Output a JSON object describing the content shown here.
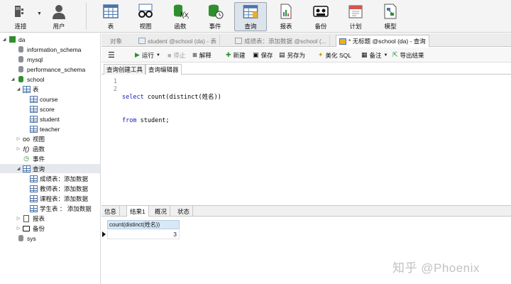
{
  "toolbar": {
    "connect": "连接",
    "user": "用户",
    "table": "表",
    "view": "视图",
    "function": "函数",
    "event": "事件",
    "query": "查询",
    "report": "报表",
    "backup": "备份",
    "schedule": "计划",
    "model": "模型"
  },
  "tree": {
    "connection": "da",
    "databases": [
      "information_schema",
      "mysql",
      "performance_schema",
      "school",
      "sys"
    ],
    "school": {
      "tables_label": "表",
      "tables": [
        "course",
        "score",
        "student",
        "teacher"
      ],
      "views_label": "视图",
      "functions_label": "函数",
      "events_label": "事件",
      "queries_label": "查询",
      "queries": [
        "成绩表：添加数据",
        "教师表：添加数据",
        "课程表：添加数据",
        "学生表 ： 添加数据"
      ],
      "reports_label": "报表",
      "backups_label": "备份"
    }
  },
  "tabs": [
    "对象",
    "student @school (da) - 表",
    "成绩表：添加数据 @school (...",
    "* 无标题 @school (da) - 查询"
  ],
  "query_toolbar": {
    "menu": "☰",
    "run": "运行",
    "stop": "停止",
    "explain": "解释",
    "new": "新建",
    "save": "保存",
    "save_as": "另存为",
    "beautify": "美化 SQL",
    "comment": "备注",
    "export": "导出结果"
  },
  "subtabs": [
    "查询创建工具",
    "查询编辑器"
  ],
  "editor": {
    "line_numbers": [
      "1",
      "2"
    ],
    "line1_kw": "select",
    "line1_rest": " count(distinct(姓名))",
    "line2_kw": "from",
    "line2_rest": " student;"
  },
  "result_tabs": [
    "信息",
    "结果1",
    "概况",
    "状态"
  ],
  "result": {
    "column": "count(distinct(姓名))",
    "value": "3"
  },
  "watermark": "知乎 @Phoenix",
  "colors": {
    "accent": "#2f8f2f",
    "selected": "#dde3ea",
    "grid_header": "#d7e8f6"
  }
}
